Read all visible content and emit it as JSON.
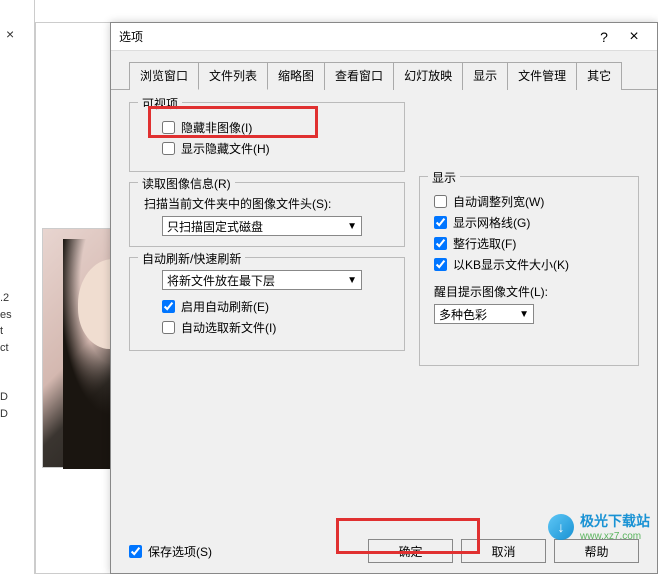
{
  "dialog": {
    "title": "选项",
    "help": "?",
    "close": "×"
  },
  "tabs": {
    "items": [
      {
        "label": "浏览窗口"
      },
      {
        "label": "文件列表"
      },
      {
        "label": "缩略图"
      },
      {
        "label": "查看窗口"
      },
      {
        "label": "幻灯放映"
      },
      {
        "label": "显示"
      },
      {
        "label": "文件管理"
      },
      {
        "label": "其它"
      }
    ],
    "active_index": 1
  },
  "groups": {
    "visible": {
      "title": "可视项",
      "hide_non_image": "隐藏非图像(I)",
      "show_hidden": "显示隐藏文件(H)"
    },
    "read_info": {
      "title": "读取图像信息(R)",
      "scan_label": "扫描当前文件夹中的图像文件头(S):",
      "scan_option": "只扫描固定式磁盘"
    },
    "auto_refresh": {
      "title": "自动刷新/快速刷新",
      "placement_option": "将新文件放在最下层",
      "enable_auto": "启用自动刷新(E)",
      "auto_select": "自动选取新文件(I)"
    },
    "display": {
      "title": "显示",
      "auto_width": "自动调整列宽(W)",
      "show_grid": "显示网格线(G)",
      "full_row": "整行选取(F)",
      "show_kb": "以KB显示文件大小(K)",
      "highlight_label": "醒目提示图像文件(L):",
      "highlight_option": "多种色彩"
    }
  },
  "footer": {
    "save_options": "保存选项(S)",
    "ok": "确定",
    "cancel": "取消",
    "help": "帮助"
  },
  "bg": {
    "close_x": "×",
    "side_lines": [
      ".2",
      "es",
      "t",
      "ct",
      "",
      "",
      "D",
      "D"
    ]
  },
  "watermark": {
    "name": "极光下载站",
    "url": "www.xz7.com"
  }
}
